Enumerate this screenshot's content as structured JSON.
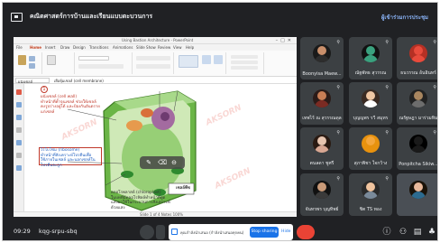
{
  "meeting": {
    "title": "คณิตศาสตร์การบ้านและเรียนแบบตะบวนการ",
    "top_right": "ผู้เข้าร่วมการประชุม"
  },
  "ppt": {
    "doc_title": "Using Bastion Architecture - PowerPoint",
    "tabs": [
      "File",
      "Home",
      "Insert",
      "Draw",
      "Design",
      "Transitions",
      "Animations",
      "Slide Show",
      "Review",
      "View",
      "Help"
    ],
    "formula_cell": "ผนังเซลล์",
    "formula_text": "เยื่อหุ้มเซลล์ (cell membrane)",
    "status_text": "Slide 1 of 4   Notes   100%"
  },
  "slide": {
    "badge": "1",
    "cap1": "ผนังเซลล์ (cell wall)\nทำหน้าที่ค้ำจุนเซลล์ ช่วยให้เซลล์\nคงรูปร่างอยู่ได้ และป้องกันอันตราย\nแก่เซลล์",
    "cap2": "ไรโบโซม (ribosome)\nทำหน้าที่สังเคราะห์โปรตีนเพื่อ\nใช้ภายในเซลล์ และนอกเซลล์ใน\nโปรตีนจะถูก",
    "cap3": "คลอโรพลาสต์ (chloroplast)\nในบทที่มีคลอโรฟิลล์ทำหน้าที่ดูด\nแสงมาใช้ในกระบวนการสังเคราะห์ด้วยแสง",
    "cell_label": "เซลล์พืช",
    "watermark": "AKSORN"
  },
  "participants": [
    {
      "name": "Boonyisa Maew...",
      "skin": "#c98f6b",
      "shirt": "#2d2d2d",
      "hair": "#1a1a1a",
      "mic_off": true
    },
    {
      "name": "ณัฐพัทธ สุวรรณ",
      "skin": "#3aa17e",
      "shirt": "#3aa17e",
      "hair": "#111111",
      "mic_off": true
    },
    {
      "name": "ธนวรรณ อ้นอินทร์",
      "skin": "#e84b3c",
      "shirt": "#e84b3c",
      "hair": "#b53024",
      "mic_off": true
    },
    {
      "name": "เทพไร้ ณ สุวรรณดุล",
      "skin": "#c97e55",
      "shirt": "#7b2b23",
      "hair": "#2b1b18",
      "mic_off": true
    },
    {
      "name": "บุญญพร รวี สมุทร",
      "skin": "#f0c7a3",
      "shirt": "#ffffff",
      "hair": "#3a2a22",
      "mic_off": true
    },
    {
      "name": "ณรัฐษฎา มาร่วมทิม",
      "skin": "#a9865f",
      "shirt": "#6d6d6d",
      "hair": "#222222",
      "mic_off": true
    },
    {
      "name": "ตนลดา ชูศรี",
      "skin": "#e7c5b0",
      "shirt": "#d8a793",
      "hair": "#2a1a12",
      "mic_off": true
    },
    {
      "name": "สุภาพิชา ใจกว้าง",
      "skin": "#f4a63b",
      "shirt": "#e8920e",
      "hair": "#e8920e",
      "mic_off": true
    },
    {
      "name": "Ponpitcha Sikiw...",
      "skin": "#1a1a1a",
      "shirt": "#1a1a1a",
      "hair": "#000000",
      "mic_off": true
    },
    {
      "name": "จันทรพร บุญทิพย์",
      "skin": "#c99a78",
      "shirt": "#3a3a3a",
      "hair": "#111111",
      "mic_off": true
    },
    {
      "name": "ชิต TS ทอง",
      "skin": "#f1c49e",
      "shirt": "#7a8a9a",
      "hair": "#2a2a2a",
      "mic_off": true
    },
    {
      "name": "",
      "skin": "#e8b89a",
      "shirt": "#2d6b8f",
      "hair": "#1a1208",
      "mic_off": false
    }
  ],
  "bottombar": {
    "clock": "09:29",
    "code": "kqg-srpu-sbq",
    "banner_text": "คุณกำลังนำเสนอ (กำลังนำเสนอทุกคน)",
    "stop_label": "Stop sharing",
    "hide_label": "Hide"
  },
  "colors": {
    "meet_dark": "#202124",
    "tile_bg": "#3c4043",
    "accent_blue": "#1a73e8",
    "end_call_red": "#ea4335",
    "cell_green": "#5fae3a"
  }
}
